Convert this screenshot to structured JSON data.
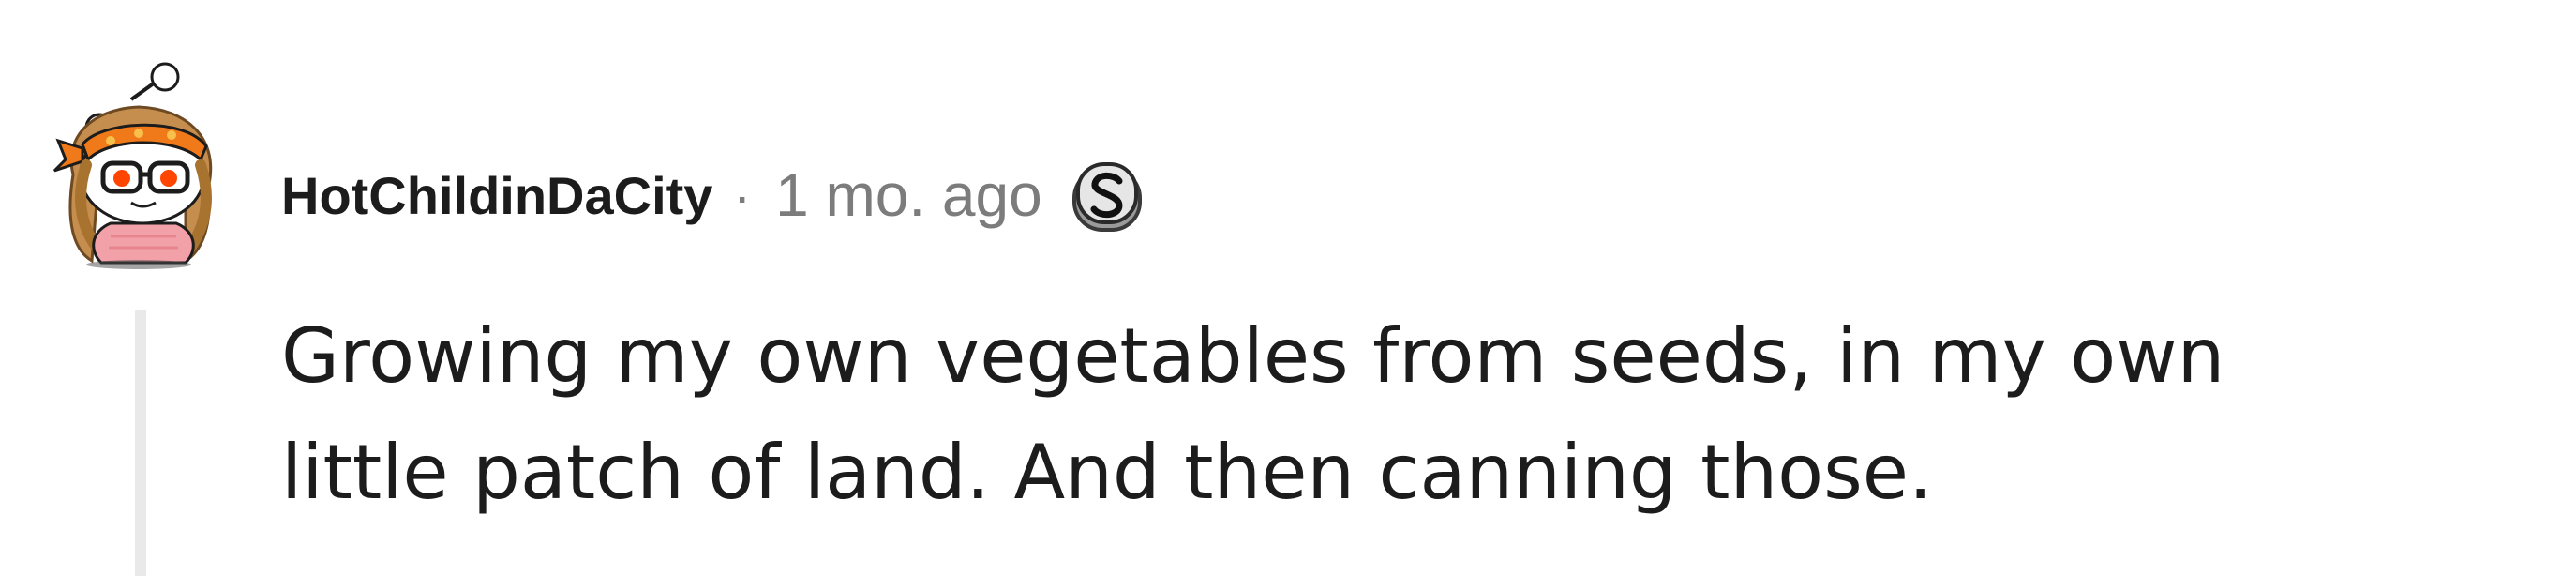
{
  "comment": {
    "author": "HotChildinDaCity",
    "separator": "·",
    "timestamp": "1 mo. ago",
    "body_lines": [
      "Growing my own vegetables from seeds, in my own",
      "little patch of land. And then canning those."
    ]
  },
  "icons": {
    "avatar": "snoo-avatar-icon",
    "flair": "silver-award-icon"
  },
  "colors": {
    "text": "#1c1c1c",
    "meta": "#7c7c7c",
    "thread_line": "#e9e9e9",
    "background": "#ffffff"
  }
}
